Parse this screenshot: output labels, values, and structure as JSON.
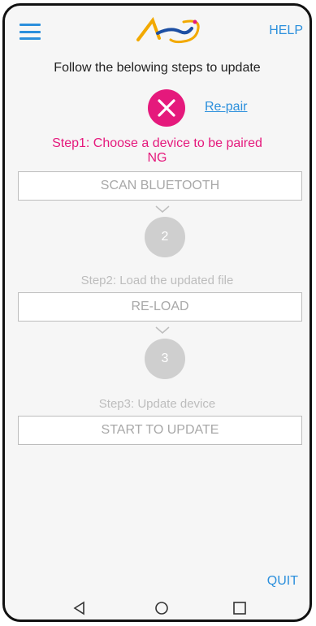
{
  "header": {
    "help_label": "HELP"
  },
  "intro_text": "Follow the belowing steps to update",
  "step1": {
    "repair_link": "Re-pair",
    "label": "Step1: Choose a device to be paired",
    "status": "NG",
    "button_label": "SCAN BLUETOOTH"
  },
  "step2": {
    "number": "2",
    "label": "Step2: Load the updated file",
    "button_label": "RE-LOAD"
  },
  "step3": {
    "number": "3",
    "label": "Step3: Update device",
    "button_label": "START TO UPDATE"
  },
  "footer": {
    "quit_label": "QUIT"
  },
  "icons": {
    "menu": "hamburger-menu-icon",
    "error": "close-icon",
    "chevron": "chevron-down-icon",
    "nav_back": "triangle-back-icon",
    "nav_home": "circle-home-icon",
    "nav_recents": "square-recents-icon"
  },
  "colors": {
    "accent": "#2b8fdc",
    "error": "#e5197c",
    "disabled": "#cfcfcf",
    "background": "#f6f6f6"
  }
}
